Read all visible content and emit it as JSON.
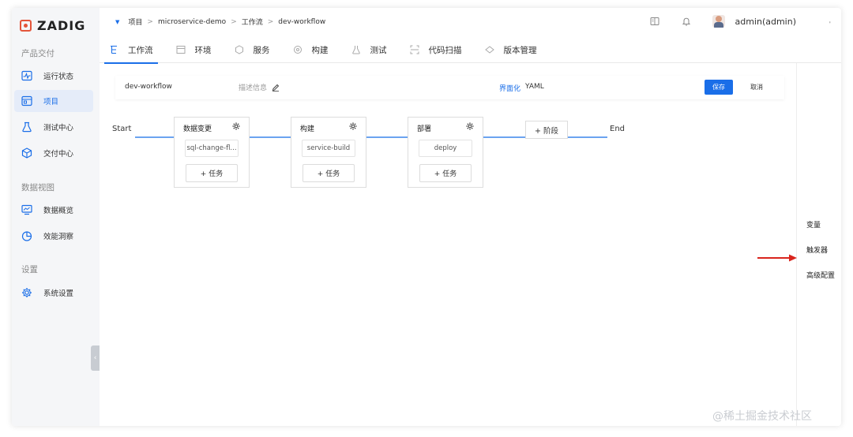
{
  "brand": {
    "name": "ZADIG",
    "color": "#e4553a"
  },
  "accent": "#1a6ee8",
  "sidebar": {
    "sections": [
      {
        "title": "产品交付",
        "items": [
          {
            "label": "运行状态",
            "icon": "pulse-chart-icon"
          },
          {
            "label": "项目",
            "icon": "project-icon",
            "active": true
          },
          {
            "label": "测试中心",
            "icon": "flask-icon"
          },
          {
            "label": "交付中心",
            "icon": "package-icon"
          }
        ]
      },
      {
        "title": "数据视图",
        "items": [
          {
            "label": "数据概览",
            "icon": "monitor-icon"
          },
          {
            "label": "效能洞察",
            "icon": "pie-chart-icon"
          }
        ]
      },
      {
        "title": "设置",
        "items": [
          {
            "label": "系统设置",
            "icon": "gear-icon"
          }
        ]
      }
    ],
    "collapse": "‹"
  },
  "breadcrumb": [
    "项目",
    "microservice-demo",
    "工作流",
    "dev-workflow"
  ],
  "breadcrumb_sep": ">",
  "user": {
    "name": "admin(admin)"
  },
  "tabs": [
    {
      "label": "工作流",
      "icon": "workflow-icon",
      "active": true
    },
    {
      "label": "环境",
      "icon": "environment-icon"
    },
    {
      "label": "服务",
      "icon": "service-icon"
    },
    {
      "label": "构建",
      "icon": "build-icon"
    },
    {
      "label": "测试",
      "icon": "test-icon"
    },
    {
      "label": "代码扫描",
      "icon": "scan-icon"
    },
    {
      "label": "版本管理",
      "icon": "version-icon"
    }
  ],
  "toolbar": {
    "workflow_name": "dev-workflow",
    "description_placeholder": "描述信息",
    "mode_ui": "界面化",
    "mode_yaml": "YAML",
    "save": "保存",
    "cancel": "取消"
  },
  "pipeline": {
    "start": "Start",
    "end": "End",
    "stages": [
      {
        "name": "数据变更",
        "job": "sql-change-fl...",
        "add_job": "+ 任务"
      },
      {
        "name": "构建",
        "job": "service-build",
        "add_job": "+ 任务"
      },
      {
        "name": "部署",
        "job": "deploy",
        "add_job": "+ 任务"
      }
    ],
    "add_stage": "+ 阶段"
  },
  "right_panel": {
    "items": [
      "变量",
      "触发器",
      "高级配置"
    ]
  },
  "watermark": "@稀土掘金技术社区"
}
